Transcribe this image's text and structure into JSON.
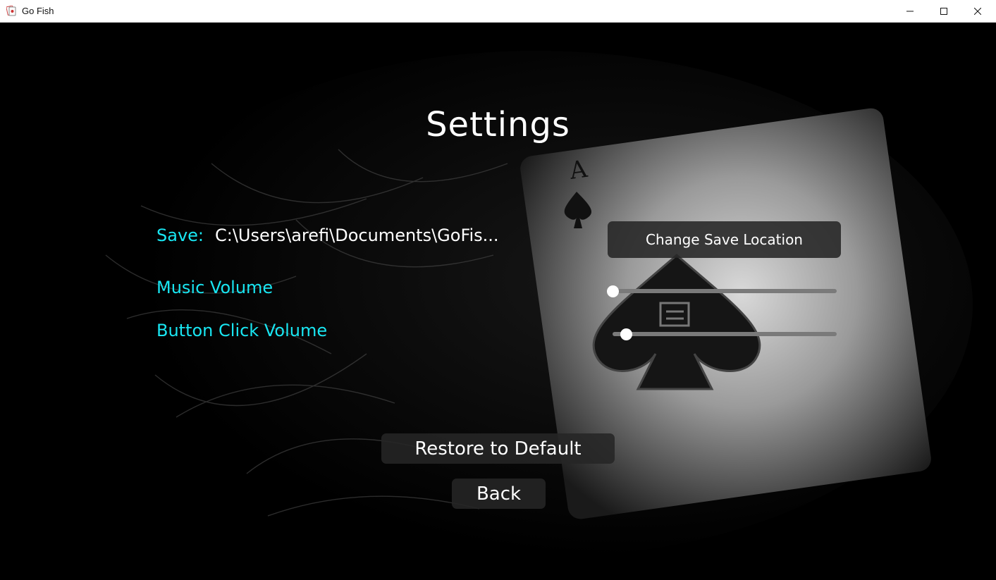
{
  "window": {
    "title": "Go Fish",
    "controls": [
      "minimize",
      "maximize",
      "close"
    ]
  },
  "settings": {
    "heading": "Settings",
    "save_label": "Save:",
    "save_path": "C:\\Users\\arefi\\Documents\\GoFis...",
    "change_save_button": "Change Save Location",
    "music_volume_label": "Music Volume",
    "music_volume_value": 0.0,
    "button_click_volume_label": "Button Click Volume",
    "button_click_volume_value": 0.06,
    "restore_button": "Restore to Default",
    "back_button": "Back"
  },
  "colors": {
    "label_cyan": "#19e6f2",
    "text_white": "#ffffff",
    "button_bg": "#262626",
    "slider_track": "#7a7a7a",
    "background": "#000000"
  },
  "background_image": "ace-of-spades-card"
}
